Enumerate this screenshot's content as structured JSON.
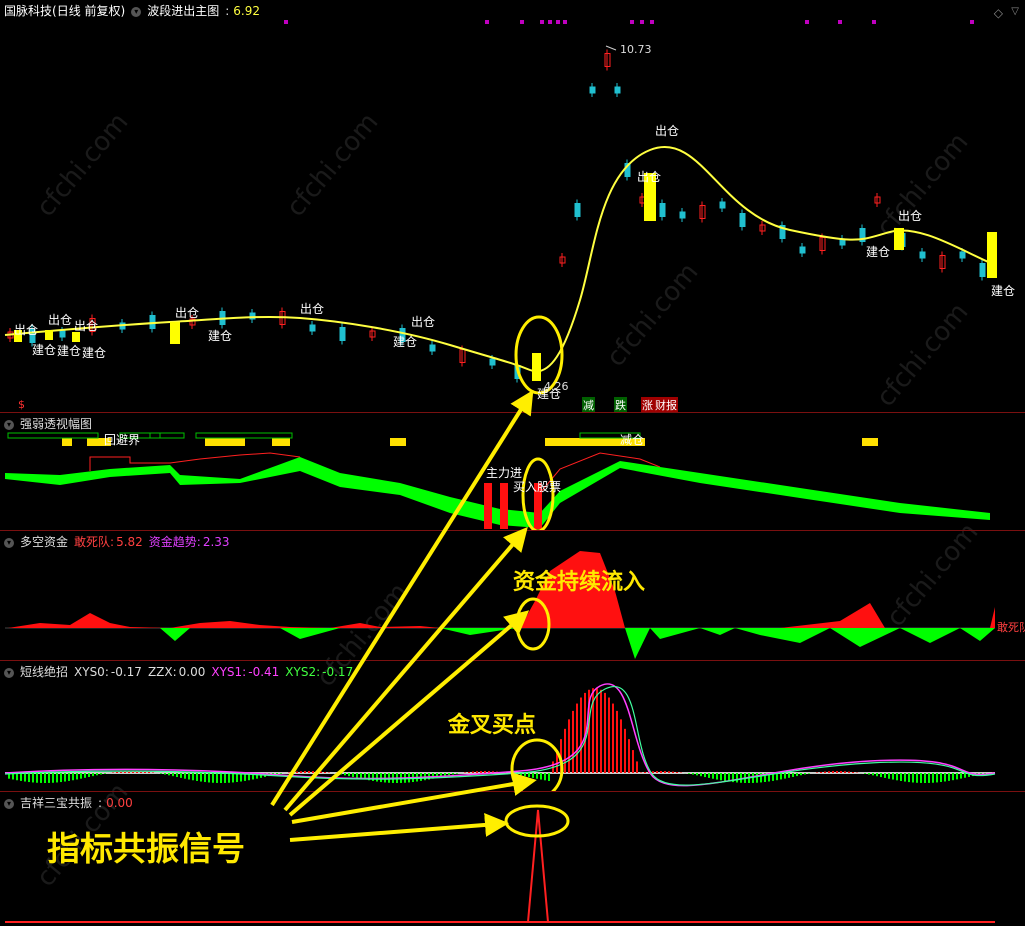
{
  "main": {
    "stock_name": "国脉科技",
    "period": "(日线 前复权)",
    "indicator": "波段进出主图",
    "indicator_value": "6.92",
    "high_label": "10.73",
    "low_label": "4.26",
    "signal_out": "出仓",
    "signal_in": "建仓",
    "tags": [
      "减",
      "跌",
      "涨",
      "财报"
    ],
    "dollar_mark": "$"
  },
  "panel2": {
    "title": "强弱透视幅图",
    "labels": [
      "主力进",
      "买入股票",
      "减仓",
      "回避界"
    ]
  },
  "panel3": {
    "title": "多空资金",
    "k1": "敢死队:",
    "v1": "5.82",
    "k2": "资金趋势:",
    "v2": "2.33",
    "edge_label": "敢死队"
  },
  "panel4": {
    "title": "短线绝招",
    "k1": "XYS0:",
    "v1": "-0.17",
    "k2": "ZZX:",
    "v2": "0.00",
    "k3": "XYS1:",
    "v3": "-0.41",
    "k4": "XYS2:",
    "v4": "-0.17"
  },
  "panel5": {
    "title": "吉祥三宝共振",
    "value": "0.00"
  },
  "annotations": {
    "fund_inflow": "资金持续流入",
    "golden_cross": "金叉买点",
    "resonance": "指标共振信号"
  },
  "watermark": "cfchi.com",
  "colors": {
    "up": "#ff2020",
    "down": "#20c0d0",
    "ma": "#ffff40",
    "accent": "#ffe800",
    "green": "#00ff00"
  }
}
